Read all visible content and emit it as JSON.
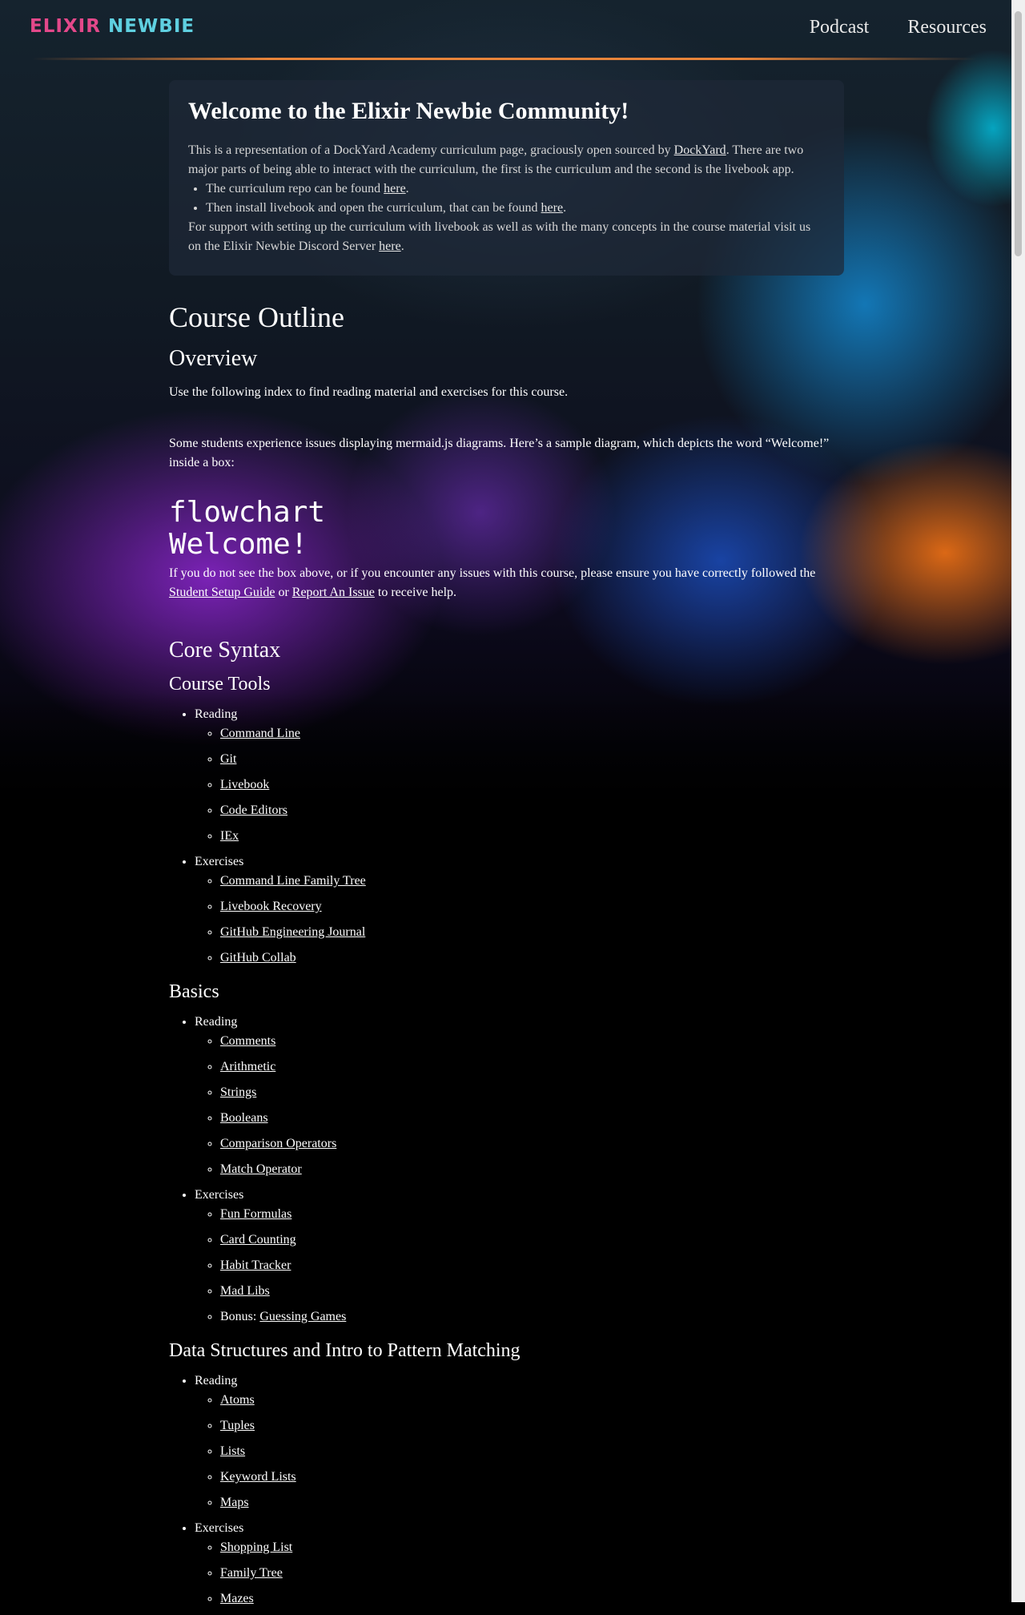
{
  "header": {
    "logo_part1": "ELIXIR",
    "logo_part2": "NEWBIE",
    "nav": [
      "Podcast",
      "Resources"
    ]
  },
  "welcome": {
    "title": "Welcome to the Elixir Newbie Community!",
    "intro_before": "This is a representation of a DockYard Academy curriculum page, graciously open sourced by ",
    "intro_link": "DockYard",
    "intro_after": ". There are two major parts of being able to interact with the curriculum, the first is the curriculum and the second is the livebook app.",
    "bullet1_before": "The curriculum repo can be found ",
    "bullet1_link": "here",
    "bullet1_after": ".",
    "bullet2_before": "Then install livebook and open the curriculum, that can be found ",
    "bullet2_link": "here",
    "bullet2_after": ".",
    "support_before": "For support with setting up the curriculum with livebook as well as with the many concepts in the course material visit us on the Elixir Newbie Discord Server ",
    "support_link": "here",
    "support_after": "."
  },
  "outline": {
    "title": "Course Outline",
    "overview_title": "Overview",
    "overview_text": "Use the following index to find reading material and exercises for this course.",
    "mermaid_note": "Some students experience issues displaying mermaid.js diagrams. Here’s a sample diagram, which depicts the word “Welcome!” inside a box:",
    "mermaid_line1": "flowchart",
    "mermaid_line2": "Welcome!",
    "help_before": "If you do not see the box above, or if you encounter any issues with this course, please ensure you have correctly followed the ",
    "help_link1": "Student Setup Guide",
    "help_mid": " or ",
    "help_link2": "Report An Issue",
    "help_after": " to receive help.",
    "core_syntax": "Core Syntax"
  },
  "sections": [
    {
      "title": "Course Tools",
      "reading_label": "Reading",
      "reading": [
        "Command Line",
        "Git",
        "Livebook",
        "Code Editors",
        "IEx"
      ],
      "exercises_label": "Exercises",
      "exercises": [
        "Command Line Family Tree",
        "Livebook Recovery",
        "GitHub Engineering Journal",
        "GitHub Collab"
      ]
    },
    {
      "title": "Basics",
      "reading_label": "Reading",
      "reading": [
        "Comments",
        "Arithmetic",
        "Strings",
        "Booleans",
        "Comparison Operators",
        "Match Operator"
      ],
      "exercises_label": "Exercises",
      "exercises": [
        "Fun Formulas",
        "Card Counting",
        "Habit Tracker",
        "Mad Libs"
      ],
      "bonus_label": "Bonus: ",
      "bonus_link": "Guessing Games"
    },
    {
      "title": "Data Structures and Intro to Pattern Matching",
      "reading_label": "Reading",
      "reading": [
        "Atoms",
        "Tuples",
        "Lists",
        "Keyword Lists",
        "Maps"
      ],
      "exercises_label": "Exercises",
      "exercises": [
        "Shopping List",
        "Family Tree",
        "Mazes"
      ]
    }
  ]
}
